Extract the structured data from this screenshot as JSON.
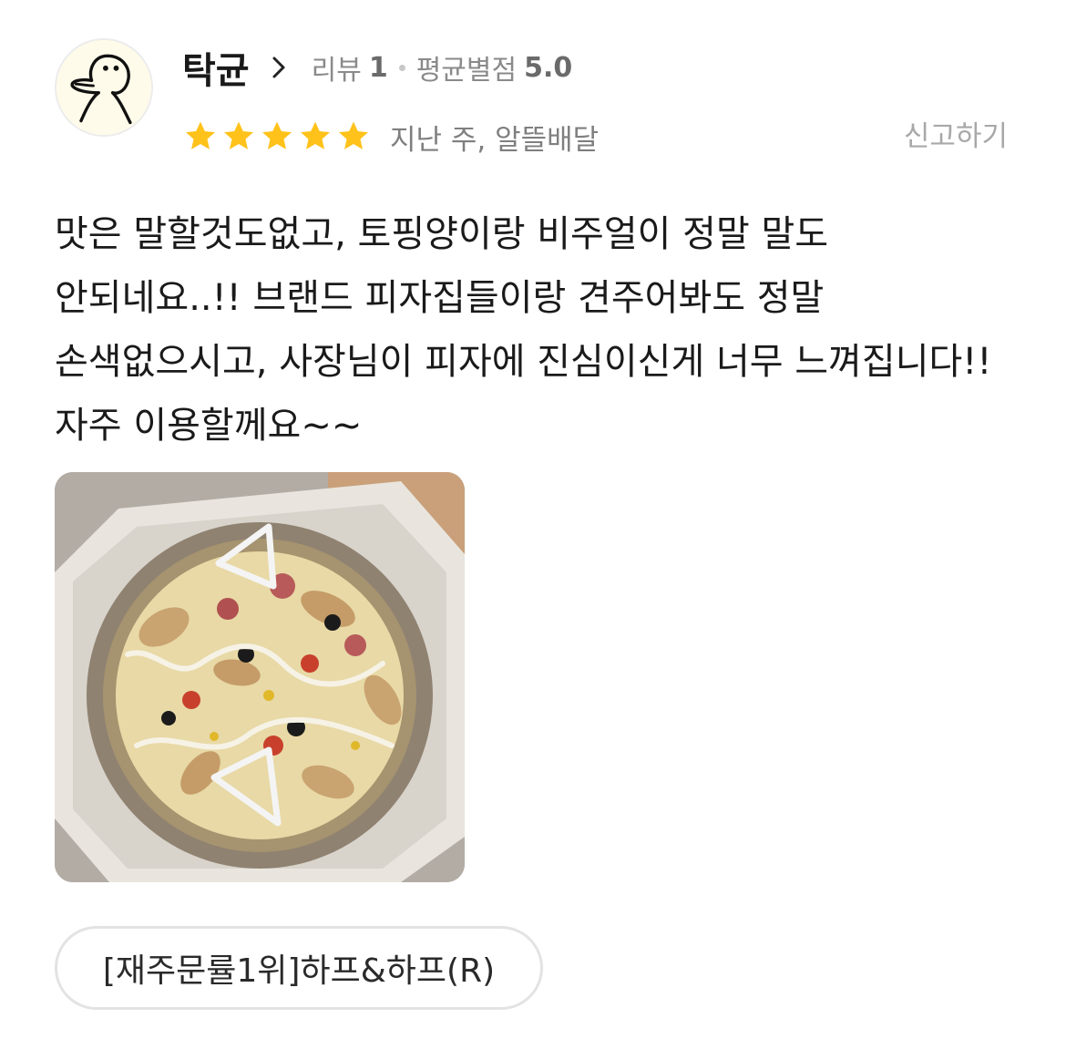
{
  "reviewer": {
    "name": "탁균",
    "review_label": "리뷰",
    "review_count": "1",
    "avg_label": "평균별점",
    "avg_rating": "5.0",
    "avatar_icon": "duck-doodle-avatar"
  },
  "rating": {
    "stars": 5,
    "star_color": "#ffc21a",
    "date": "지난 주, 알뜰배달"
  },
  "actions": {
    "report_label": "신고하기"
  },
  "review": {
    "text": "맛은 말할것도없고, 토핑양이랑 비주얼이 정말 말도 안되네요..!! 브랜드 피자집들이랑 견주어봐도 정말 손색없으시고, 사장님이 피자에 진심이신게 너무 느껴집니다!!\n자주 이용할께요~~"
  },
  "photo": {
    "icon": "pizza-photo"
  },
  "menu": {
    "item": "[재주문률1위]하프&하프(R)"
  }
}
